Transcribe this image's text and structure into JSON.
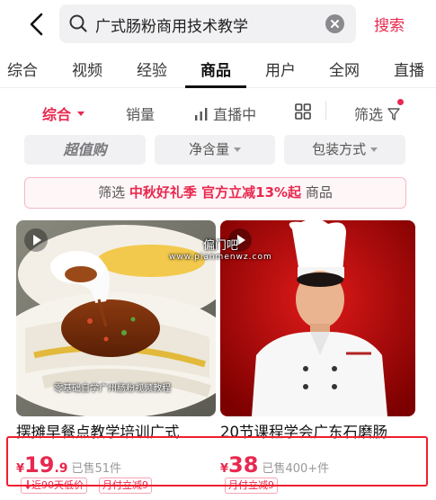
{
  "header": {
    "query": "广式肠粉商用技术教学",
    "search_label": "搜索"
  },
  "tabs": [
    "综合",
    "视频",
    "经验",
    "商品",
    "用户",
    "全网",
    "直播"
  ],
  "active_tab": "商品",
  "sort": {
    "items": [
      "综合",
      "销量",
      "直播中",
      "筛选"
    ],
    "active": "综合"
  },
  "chips": [
    "超值购",
    "净含量",
    "包装方式"
  ],
  "promo": {
    "prefix": "筛选",
    "highlight": "中秋好礼季 官方立减13%起",
    "suffix": "商品"
  },
  "watermark": {
    "name": "偏门吧",
    "url": "www.pianmenwz.com"
  },
  "products": [
    {
      "title": "摆摊早餐点教学培训广式",
      "price_symbol": "¥",
      "price_int": "19",
      "price_dec": ".9",
      "sold": "已售51件",
      "badges": [
        "近90天低价",
        "月付立减9"
      ],
      "image_caption": "零基础自学广州肠粉视频教程"
    },
    {
      "title": "20节课程学会广东石磨肠",
      "price_symbol": "¥",
      "price_int": "38",
      "price_dec": "",
      "sold": "已售400+件",
      "badges": [
        "月付立减9"
      ],
      "image_caption": ""
    }
  ],
  "colors": {
    "accent": "#e8294f",
    "highlight_border": "#f01f2e",
    "chip_bg": "#f1f1f3"
  }
}
